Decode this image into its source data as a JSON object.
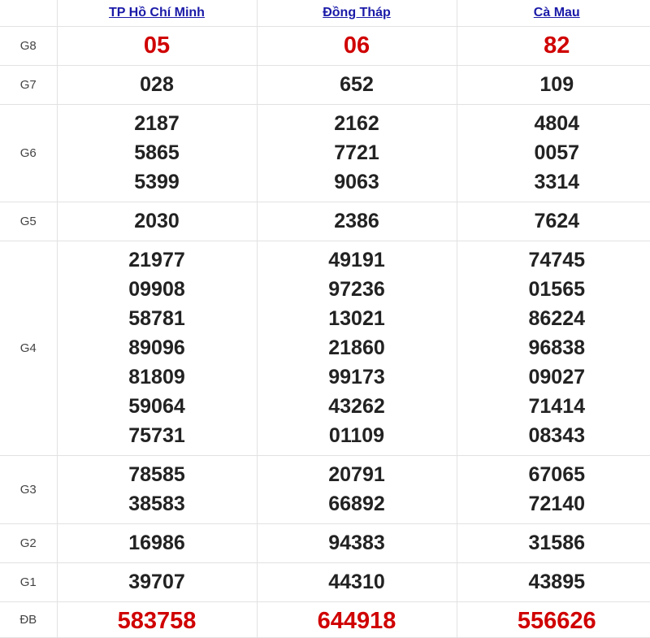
{
  "provinces": [
    "TP Hồ Chí Minh",
    "Đồng Tháp",
    "Cà Mau"
  ],
  "accent_color": "#d00000",
  "link_color": "#1a1aa8",
  "prizes": [
    {
      "label": "G8",
      "values": [
        [
          "05"
        ],
        [
          "06"
        ],
        [
          "82"
        ]
      ]
    },
    {
      "label": "G7",
      "values": [
        [
          "028"
        ],
        [
          "652"
        ],
        [
          "109"
        ]
      ]
    },
    {
      "label": "G6",
      "values": [
        [
          "2187",
          "5865",
          "5399"
        ],
        [
          "2162",
          "7721",
          "9063"
        ],
        [
          "4804",
          "0057",
          "3314"
        ]
      ]
    },
    {
      "label": "G5",
      "values": [
        [
          "2030"
        ],
        [
          "2386"
        ],
        [
          "7624"
        ]
      ]
    },
    {
      "label": "G4",
      "values": [
        [
          "21977",
          "09908",
          "58781",
          "89096",
          "81809",
          "59064",
          "75731"
        ],
        [
          "49191",
          "97236",
          "13021",
          "21860",
          "99173",
          "43262",
          "01109"
        ],
        [
          "74745",
          "01565",
          "86224",
          "96838",
          "09027",
          "71414",
          "08343"
        ]
      ]
    },
    {
      "label": "G3",
      "values": [
        [
          "78585",
          "38583"
        ],
        [
          "20791",
          "66892"
        ],
        [
          "67065",
          "72140"
        ]
      ]
    },
    {
      "label": "G2",
      "values": [
        [
          "16986"
        ],
        [
          "94383"
        ],
        [
          "31586"
        ]
      ]
    },
    {
      "label": "G1",
      "values": [
        [
          "39707"
        ],
        [
          "44310"
        ],
        [
          "43895"
        ]
      ]
    },
    {
      "label": "ĐB",
      "values": [
        [
          "583758"
        ],
        [
          "644918"
        ],
        [
          "556626"
        ]
      ]
    }
  ]
}
